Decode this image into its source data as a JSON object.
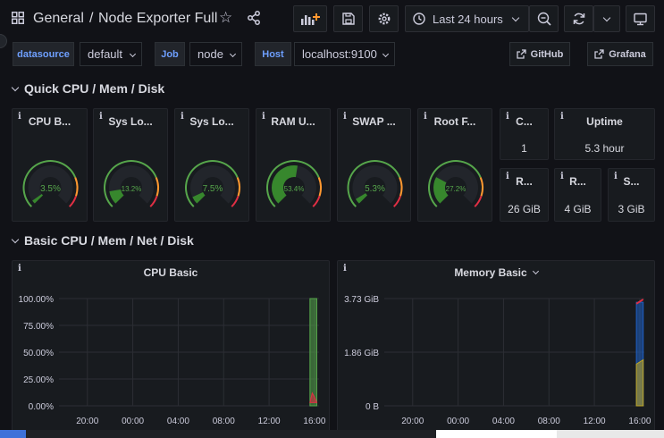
{
  "header": {
    "breadcrumb_folder": "General",
    "breadcrumb_separator": "/",
    "dashboard_title": "Node Exporter Full",
    "time_range": "Last 24 hours"
  },
  "variables": [
    {
      "label": "datasource",
      "value": "default"
    },
    {
      "label": "Job",
      "value": "node"
    },
    {
      "label": "Host",
      "value": "localhost:9100"
    }
  ],
  "links": [
    {
      "label": "GitHub"
    },
    {
      "label": "Grafana"
    }
  ],
  "rows": {
    "quick": "Quick CPU / Mem / Disk",
    "basic": "Basic CPU / Mem / Net / Disk"
  },
  "gauges": [
    {
      "title": "CPU B...",
      "value": "3.5%",
      "fraction": 0.035
    },
    {
      "title": "Sys Lo...",
      "value": "13.2%",
      "fraction": 0.132
    },
    {
      "title": "Sys Lo...",
      "value": "7.5%",
      "fraction": 0.075
    },
    {
      "title": "RAM U...",
      "value": "53.4%",
      "fraction": 0.534
    },
    {
      "title": "SWAP ...",
      "value": "5.3%",
      "fraction": 0.053
    },
    {
      "title": "Root F...",
      "value": "27.2%",
      "fraction": 0.272
    }
  ],
  "stats": [
    {
      "title": "C...",
      "value": "1"
    },
    {
      "title": "Uptime",
      "value": "5.3 hour"
    },
    {
      "title": "R...",
      "value": "26 GiB"
    },
    {
      "title": "R...",
      "value": "4 GiB"
    },
    {
      "title": "S...",
      "value": "3 GiB"
    }
  ],
  "info_glyph": "i",
  "colors": {
    "green": "#37872d",
    "green_bright": "#56a64b",
    "threshold_orange": "#ff9830",
    "threshold_red": "#e02f44",
    "yellow": "#c0a622",
    "blue": "#1f60c4"
  },
  "chart_data": [
    {
      "type": "area",
      "title": "CPU Basic",
      "y_ticks": [
        "100.00%",
        "75.00%",
        "50.00%",
        "25.00%",
        "0.00%"
      ],
      "x_ticks": [
        "20:00",
        "00:00",
        "04:00",
        "08:00",
        "12:00",
        "16:00"
      ],
      "ylim": [
        0,
        100
      ],
      "x_hours": [
        16,
        20,
        24,
        28,
        32,
        36,
        40
      ],
      "series": [
        {
          "color": "#56a64b",
          "x": [
            39.6,
            39.6,
            40.2,
            40.2
          ],
          "values": [
            0,
            100,
            100,
            0
          ]
        },
        {
          "color": "#e02f44",
          "x": [
            39.6,
            39.8,
            40.0,
            40.2
          ],
          "values": [
            3,
            12,
            8,
            3
          ]
        }
      ]
    },
    {
      "type": "area",
      "title": "Memory Basic",
      "y_ticks": [
        "3.73 GiB",
        "1.86 GiB",
        "0 B"
      ],
      "x_ticks": [
        "20:00",
        "00:00",
        "04:00",
        "08:00",
        "12:00",
        "16:00"
      ],
      "ylim": [
        0,
        3.73
      ],
      "x_hours": [
        16,
        20,
        24,
        28,
        32,
        36,
        40
      ],
      "series": [
        {
          "color": "#1f60c4",
          "x": [
            39.7,
            39.7,
            40.3,
            40.3
          ],
          "values": [
            0,
            3.6,
            3.6,
            0
          ]
        },
        {
          "color": "#c0a622",
          "x": [
            39.7,
            39.7,
            40.3,
            40.3
          ],
          "values": [
            0,
            1.45,
            1.6,
            0
          ]
        },
        {
          "color": "#e02f44",
          "x": [
            39.7,
            40.3
          ],
          "values": [
            3.55,
            3.7
          ]
        }
      ]
    }
  ]
}
